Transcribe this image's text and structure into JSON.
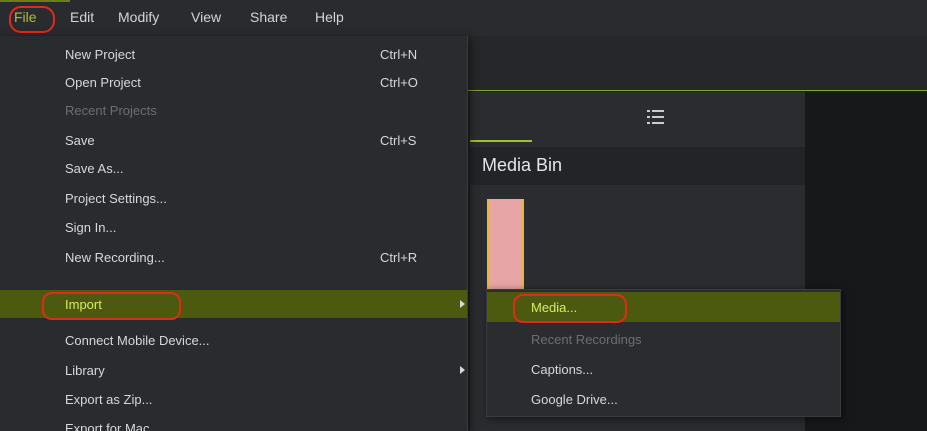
{
  "menubar": {
    "items": [
      {
        "label": "File"
      },
      {
        "label": "Edit"
      },
      {
        "label": "Modify"
      },
      {
        "label": "View"
      },
      {
        "label": "Share"
      },
      {
        "label": "Help"
      }
    ]
  },
  "media_bin": {
    "title": "Media Bin"
  },
  "file_menu": {
    "items": [
      {
        "label": "New Project",
        "shortcut": "Ctrl+N"
      },
      {
        "label": "Open Project",
        "shortcut": "Ctrl+O"
      },
      {
        "label": "Recent Projects"
      },
      {
        "label": "Save",
        "shortcut": "Ctrl+S"
      },
      {
        "label": "Save As..."
      },
      {
        "label": "Project Settings..."
      },
      {
        "label": "Sign In..."
      },
      {
        "label": "New Recording...",
        "shortcut": "Ctrl+R"
      },
      {
        "label": "Import"
      },
      {
        "label": "Connect Mobile Device..."
      },
      {
        "label": "Library"
      },
      {
        "label": "Export as Zip..."
      },
      {
        "label": "Export for Mac..."
      }
    ]
  },
  "import_submenu": {
    "items": [
      {
        "label": "Media..."
      },
      {
        "label": "Recent Recordings"
      },
      {
        "label": "Captions..."
      },
      {
        "label": "Google Drive..."
      }
    ]
  },
  "colors": {
    "accent": "#9cc230",
    "highlight": "#4b5a0f",
    "annotation_red": "#e22a1a"
  }
}
